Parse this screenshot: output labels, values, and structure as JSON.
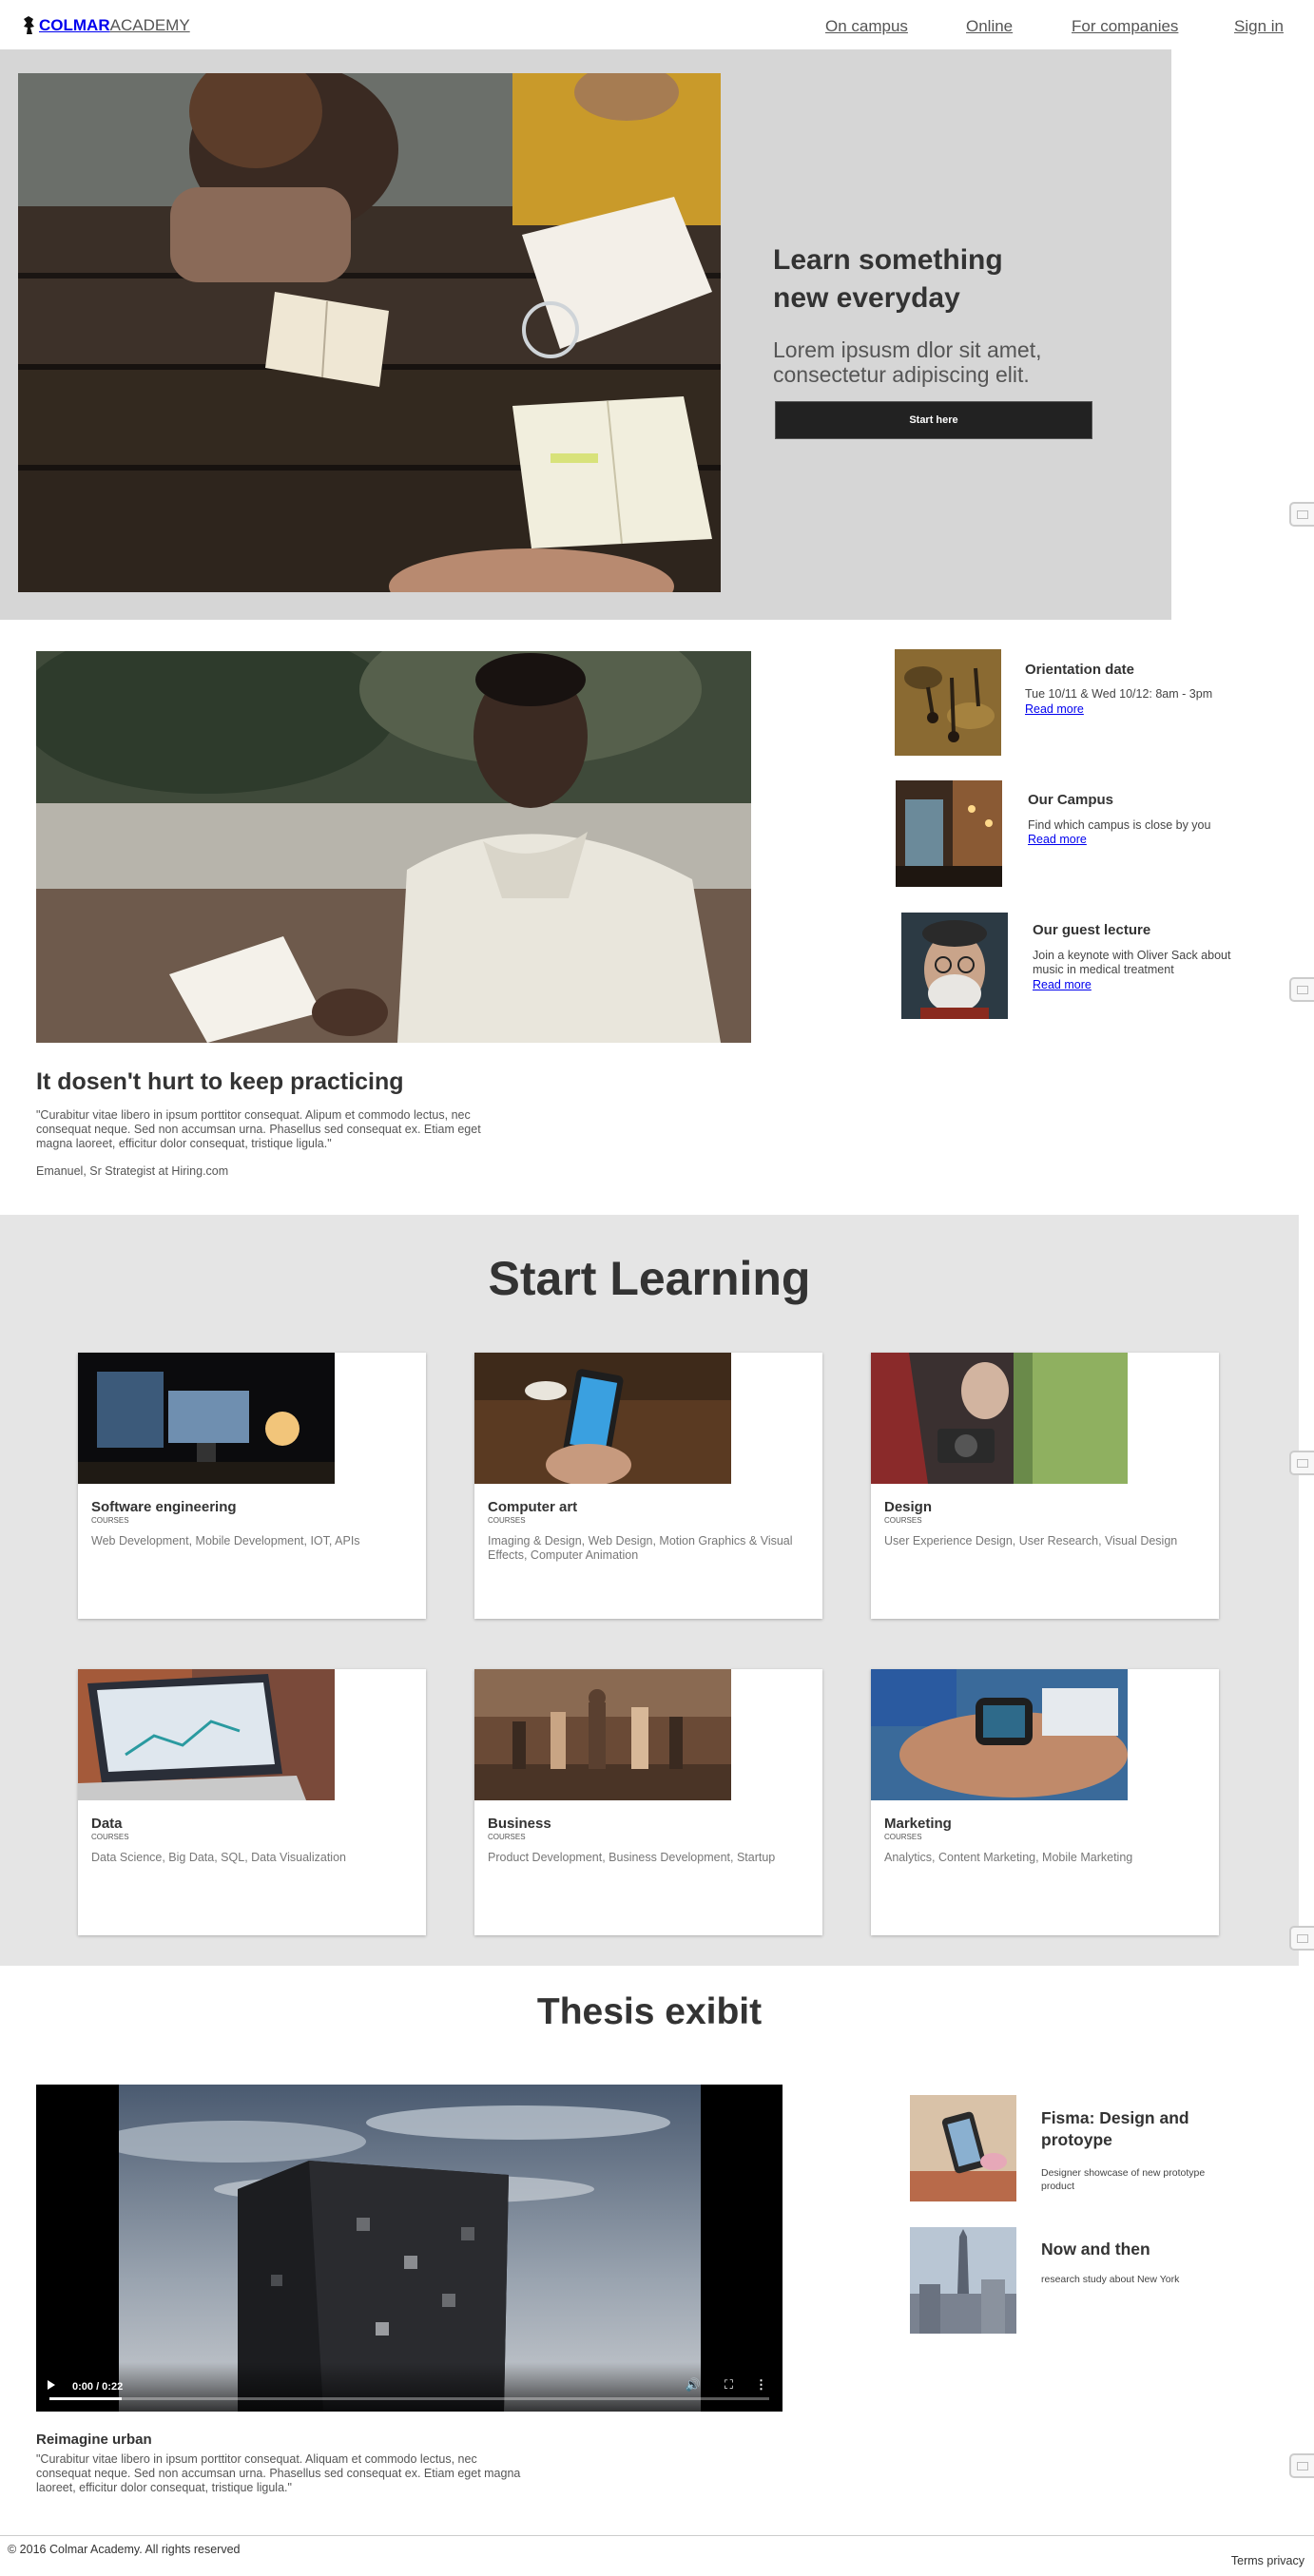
{
  "nav": {
    "logo_bold": "COLMAR",
    "logo_rest": "ACADEMY",
    "links": [
      "On campus",
      "Online",
      "For companies",
      "Sign in"
    ]
  },
  "hero": {
    "title": "Learn something new everyday",
    "subtitle": "Lorem ipsusm dlor sit amet, consectetur adipiscing elit.",
    "button": "Start here"
  },
  "practice": {
    "title": "It dosen't hurt to keep practicing",
    "quote": "\"Curabitur vitae libero in ipsum porttitor consequat. Alipum et commodo lectus, nec consequat neque. Sed non accumsan urna. Phasellus sed consequat ex. Etiam eget magna laoreet, efficitur dolor consequat, tristique ligula.\"",
    "author": "Emanuel, Sr Strategist at Hiring.com"
  },
  "events": [
    {
      "title": "Orientation date",
      "desc": "Tue 10/11 & Wed 10/12: 8am - 3pm",
      "link": "Read more"
    },
    {
      "title": "Our Campus",
      "desc": "Find which campus is close by you",
      "link": "Read more"
    },
    {
      "title": "Our guest lecture",
      "desc": "Join a keynote with Oliver Sack about music in medical treatment",
      "link": "Read more"
    }
  ],
  "learn": {
    "title": "Start Learning",
    "kind": "COURSES",
    "courses": [
      {
        "title": "Software engineering",
        "desc": "Web Development, Mobile Development, IOT, APIs"
      },
      {
        "title": "Computer art",
        "desc": "Imaging & Design, Web Design, Motion Graphics & Visual Effects, Computer Animation"
      },
      {
        "title": "Design",
        "desc": "User Experience Design, User Research, Visual Design"
      },
      {
        "title": "Data",
        "desc": "Data Science, Big Data, SQL, Data Visualization"
      },
      {
        "title": "Business",
        "desc": "Product Development, Business Development, Startup"
      },
      {
        "title": "Marketing",
        "desc": "Analytics, Content Marketing, Mobile Marketing"
      }
    ]
  },
  "thesis": {
    "title": "Thesis exibit",
    "video_time": "0:00 / 0:22",
    "video_progress": 0.1,
    "reimagine_title": "Reimagine urban",
    "reimagine_quote": "\"Curabitur vitae libero in ipsum porttitor consequat. Aliquam et commodo lectus, nec consequat neque. Sed non accumsan urna. Phasellus sed consequat ex. Etiam eget magna laoreet, efficitur dolor consequat, tristique ligula.\"",
    "projects": [
      {
        "title": "Fisma: Design and protoype",
        "desc": "Designer showcase of new prototype product"
      },
      {
        "title": "Now and then",
        "desc": "research study about New York"
      }
    ]
  },
  "footer": {
    "copyright": "© 2016 Colmar Academy. All rights reserved",
    "terms": "Terms privacy"
  }
}
